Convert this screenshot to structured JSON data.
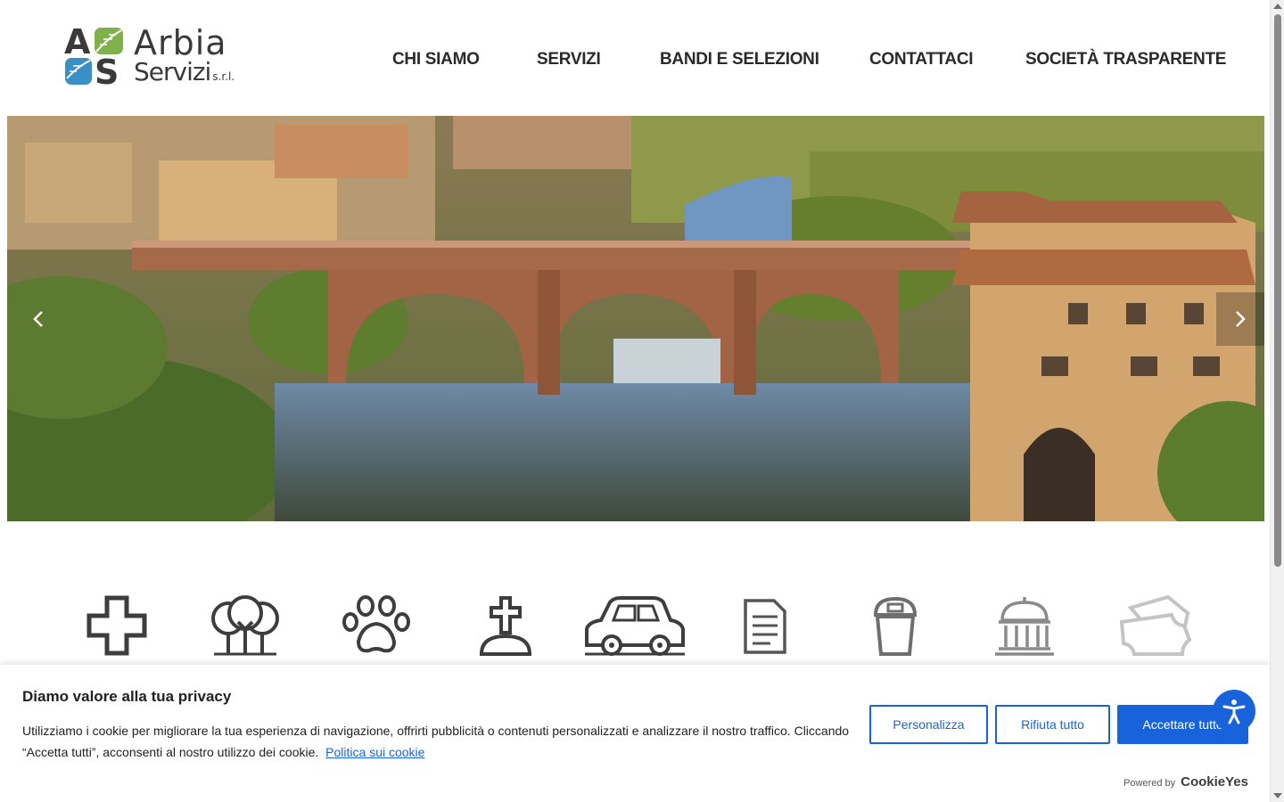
{
  "brand": {
    "name_line1": "Arbia",
    "name_line2": "Servizi",
    "name_suffix": "s.r.l.",
    "mark_letters": [
      "A",
      "S"
    ],
    "leaf_color": "#7fb24a",
    "water_color": "#3a8fc4"
  },
  "nav": {
    "items": [
      {
        "label": "CHI SIAMO"
      },
      {
        "label": "SERVIZI"
      },
      {
        "label": "BANDI E SELEZIONI"
      },
      {
        "label": "CONTATTACI"
      },
      {
        "label": "SOCIETÀ TRASPARENTE"
      }
    ]
  },
  "hero": {
    "prev_icon": "chevron-left-icon",
    "next_icon": "chevron-right-icon"
  },
  "services": {
    "icons": [
      "cross-icon",
      "trees-icon",
      "paw-icon",
      "grave-cross-icon",
      "car-icon",
      "document-icon",
      "trash-bin-icon",
      "temple-icon",
      "tickets-icon"
    ]
  },
  "cookie_banner": {
    "title": "Diamo valore alla tua privacy",
    "text": "Utilizziamo i cookie per migliorare la tua esperienza di navigazione, offrirti pubblicità o contenuti personalizzati e analizzare il nostro traffico. Cliccando “Accetta tutti”, acconsenti al nostro utilizzo dei cookie.",
    "policy_link": "Politica sui cookie",
    "buttons": {
      "customize": "Personalizza",
      "reject": "Rifiuta tutto",
      "accept": "Accettare tutto"
    },
    "powered_label": "Powered by",
    "powered_brand": "CookieYes",
    "accent_color": "#1863dc"
  },
  "accessibility": {
    "icon": "accessibility-icon"
  }
}
